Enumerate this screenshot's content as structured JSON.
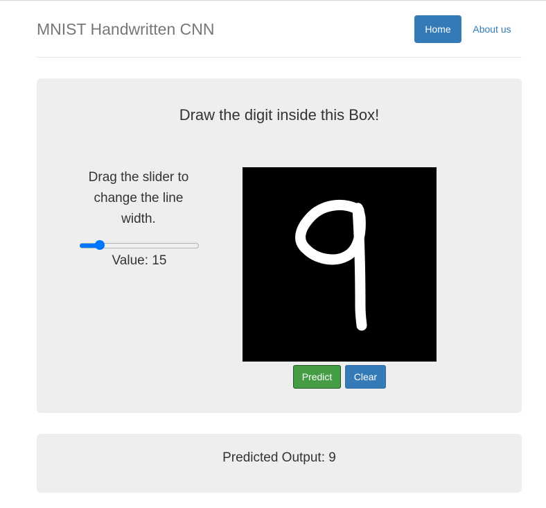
{
  "navbar": {
    "brand": "MNIST Handwritten CNN",
    "items": [
      {
        "label": "Home",
        "active": true
      },
      {
        "label": "About us",
        "active": false
      }
    ]
  },
  "draw_panel": {
    "heading": "Draw the digit inside this Box!",
    "slider_instructions": "Drag the slider to change the line width.",
    "slider": {
      "value": 15,
      "min": 1,
      "max": 100
    },
    "value_label": "Value:",
    "value": "15",
    "canvas_content": "handwritten digit 9",
    "buttons": {
      "predict": "Predict",
      "clear": "Clear"
    }
  },
  "output": {
    "label": "Predicted Output:",
    "value": "9"
  },
  "colors": {
    "primary": "#337ab7",
    "success": "#449d44",
    "panel_bg": "#eeeeee",
    "canvas_bg": "#000000",
    "stroke": "#ffffff",
    "slider_accent": "#0075ff"
  }
}
